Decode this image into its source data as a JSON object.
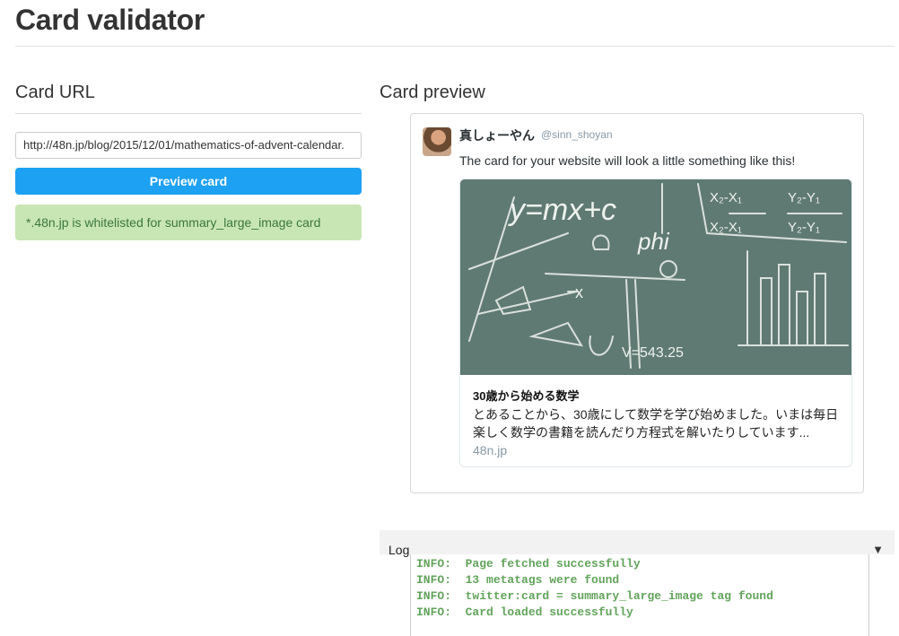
{
  "page": {
    "title": "Card validator"
  },
  "left": {
    "section_title": "Card URL",
    "url_value": "http://48n.jp/blog/2015/12/01/mathematics-of-advent-calendar.",
    "preview_button": "Preview card",
    "whitelist_message": "*.48n.jp is whitelisted for summary_large_image card"
  },
  "right": {
    "section_title": "Card preview",
    "tweet": {
      "display_name": "真しょーやん",
      "screen_name": "@sinn_shoyan",
      "text": "The card for your website will look a little something like this!"
    },
    "card": {
      "title": "30歳から始める数学",
      "description": "とあることから、30歳にして数学を学び始めました。いまは毎日楽しく数学の書籍を読んだり方程式を解いたりしています...",
      "domain": "48n.jp",
      "image_text": {
        "equation": "y=mx+c",
        "phi": "phi",
        "x_var": "x",
        "v_value": "V=543.25",
        "fraction_left_top": "X₂-X₁",
        "fraction_left_bottom": "X₂-X₁",
        "fraction_right_top": "Y₂-Y₁",
        "fraction_right_bottom": "Y₂-Y₁"
      }
    }
  },
  "log": {
    "label": "Log",
    "toggle_icon": "▼",
    "lines": [
      "INFO:  Page fetched successfully",
      "INFO:  13 metatags were found",
      "INFO:  twitter:card = summary_large_image tag found",
      "INFO:  Card loaded successfully"
    ]
  },
  "colors": {
    "button": "#1da1f2",
    "success_bg": "#c8e6b4",
    "success_text": "#3c763d",
    "log_text": "#62a35b",
    "chalkboard": "#5f7a73"
  }
}
